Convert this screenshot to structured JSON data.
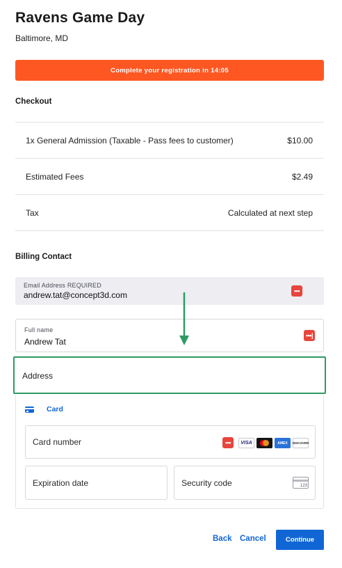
{
  "header": {
    "event_title": "Ravens Game Day",
    "location": "Baltimore, MD"
  },
  "timer_banner": {
    "text": "Complete your registration in 14:05",
    "color": "#ff5722"
  },
  "checkout": {
    "heading": "Checkout",
    "rows": [
      {
        "label": "1x General Admission (Taxable - Pass fees to customer)",
        "value": "$10.00"
      },
      {
        "label": "Estimated Fees",
        "value": "$2.49"
      },
      {
        "label": "Tax",
        "value": "Calculated at next step"
      }
    ]
  },
  "billing": {
    "heading": "Billing Contact",
    "email_label": "Email Address REQUIRED",
    "email_value": "andrew.tat@concept3d.com",
    "name_label": "Full name",
    "name_value": "Andrew Tat",
    "address_placeholder": "Address",
    "highlight_color": "#2e9a63"
  },
  "payment": {
    "tab_label": "Card",
    "card_number_placeholder": "Card number",
    "expiry_placeholder": "Expiration date",
    "security_code_placeholder": "Security code",
    "cvc_hint": "123",
    "brands": {
      "visa": "VISA",
      "amex": "AMEX",
      "discover": "DISCOVER"
    },
    "accent_color": "#1166d6"
  },
  "footer": {
    "back_label": "Back",
    "cancel_label": "Cancel",
    "continue_label": "Continue"
  }
}
